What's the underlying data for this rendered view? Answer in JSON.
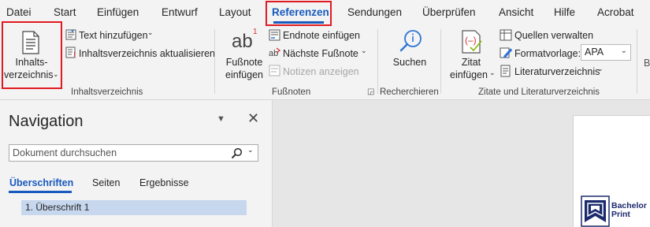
{
  "tabs": [
    "Datei",
    "Start",
    "Einfügen",
    "Entwurf",
    "Layout",
    "Referenzen",
    "Sendungen",
    "Überprüfen",
    "Ansicht",
    "Hilfe",
    "Acrobat"
  ],
  "active_tab": "Referenzen",
  "ribbon": {
    "toc": {
      "button_line1": "Inhalts-",
      "button_line2": "verzeichnis",
      "add_text": "Text hinzufügen",
      "update_toc": "Inhaltsverzeichnis aktualisieren",
      "group_label": "Inhaltsverzeichnis"
    },
    "footnotes": {
      "icon_text": "ab",
      "icon_superscript": "1",
      "insert_line1": "Fußnote",
      "insert_line2": "einfügen",
      "endnote": "Endnote einfügen",
      "next_footnote": "Nächste Fußnote",
      "show_notes": "Notizen anzeigen",
      "group_label": "Fußnoten"
    },
    "research": {
      "search": "Suchen",
      "group_label": "Recherchieren"
    },
    "citations": {
      "insert_line1": "Zitat",
      "insert_line2": "einfügen",
      "manage_sources": "Quellen verwalten",
      "style_label": "Formatvorlage:",
      "style_value": "APA",
      "bibliography": "Literaturverzeichnis",
      "group_label": "Zitate und Literaturverzeichnis"
    }
  },
  "navigation": {
    "title": "Navigation",
    "search_placeholder": "Dokument durchsuchen",
    "tabs": [
      "Überschriften",
      "Seiten",
      "Ergebnisse"
    ],
    "active_tab": "Überschriften",
    "headings": [
      "1. Überschrift 1"
    ]
  },
  "logo": {
    "line1": "Bachelor",
    "line2": "Print"
  },
  "colors": {
    "accent": "#185abd",
    "highlight_box": "#e11a22",
    "ribbon_bg": "#f3f3f3",
    "heading_selected": "#c7d7ee"
  }
}
